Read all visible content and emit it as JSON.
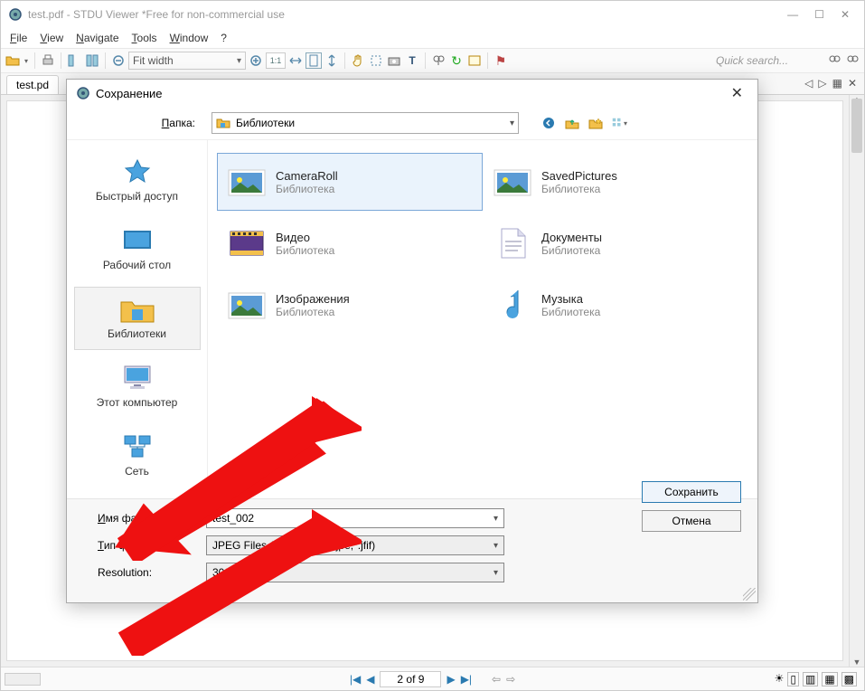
{
  "window": {
    "title": "test.pdf - STDU Viewer *Free for non-commercial use"
  },
  "menu": {
    "file": "File",
    "view": "View",
    "navigate": "Navigate",
    "tools": "Tools",
    "window": "Window",
    "help": "?"
  },
  "toolbar": {
    "fit_mode": "Fit width",
    "page_num_box": "1:1",
    "search_placeholder": "Quick search..."
  },
  "tabs": {
    "current": "test.pd"
  },
  "status": {
    "page_text": "2 of 9"
  },
  "dialog": {
    "title": "Сохранение",
    "folder_label": "Папка:",
    "folder_value": "Библиотеки",
    "places": [
      {
        "label": "Быстрый доступ",
        "icon": "star"
      },
      {
        "label": "Рабочий стол",
        "icon": "desktop"
      },
      {
        "label": "Библиотеки",
        "icon": "libraries",
        "selected": true
      },
      {
        "label": "Этот компьютер",
        "icon": "pc"
      },
      {
        "label": "Сеть",
        "icon": "network"
      }
    ],
    "items": [
      {
        "name": "CameraRoll",
        "sub": "Библиотека",
        "icon": "pictures",
        "selected": true
      },
      {
        "name": "SavedPictures",
        "sub": "Библиотека",
        "icon": "pictures"
      },
      {
        "name": "Видео",
        "sub": "Библиотека",
        "icon": "video"
      },
      {
        "name": "Документы",
        "sub": "Библиотека",
        "icon": "docs"
      },
      {
        "name": "Изображения",
        "sub": "Библиотека",
        "icon": "pictures"
      },
      {
        "name": "Музыка",
        "sub": "Библиотека",
        "icon": "music"
      }
    ],
    "filename_label": "Имя файла:",
    "filename_value": "test_002",
    "filetype_label": "Тип файла:",
    "filetype_value": "JPEG Files (*.jpg;*.jpeg;*.jpe;*.jfif)",
    "resolution_label": "Resolution:",
    "resolution_value": "300 DPI",
    "save_btn": "Сохранить",
    "cancel_btn": "Отмена"
  }
}
